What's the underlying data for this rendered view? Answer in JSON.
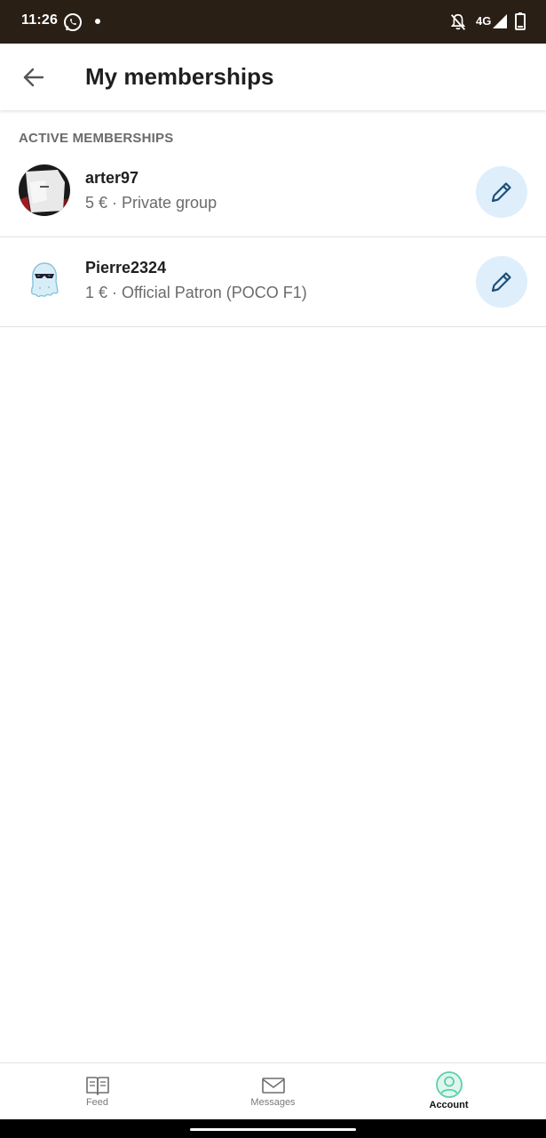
{
  "status_bar": {
    "time": "11:26",
    "network": "4G",
    "icons": [
      "whatsapp-icon",
      "notification-dot",
      "bell-off-icon",
      "signal-icon",
      "battery-icon"
    ]
  },
  "header": {
    "title": "My memberships",
    "back_icon": "arrow-left-icon"
  },
  "section": {
    "label": "ACTIVE MEMBERSHIPS"
  },
  "memberships": [
    {
      "name": "arter97",
      "details": "5 € · Private group",
      "edit_icon": "pencil-icon"
    },
    {
      "name": "Pierre2324",
      "details": "1 € · Official Patron (POCO F1)",
      "edit_icon": "pencil-icon"
    }
  ],
  "bottom_nav": {
    "items": [
      {
        "label": "Feed",
        "icon": "book-icon",
        "active": false
      },
      {
        "label": "Messages",
        "icon": "envelope-icon",
        "active": false
      },
      {
        "label": "Account",
        "icon": "user-circle-icon",
        "active": true
      }
    ]
  },
  "colors": {
    "status_bar_bg": "#2a1f15",
    "edit_button_bg": "#deeefb",
    "edit_icon": "#1e4f78",
    "account_accent": "#5ccfa8"
  }
}
